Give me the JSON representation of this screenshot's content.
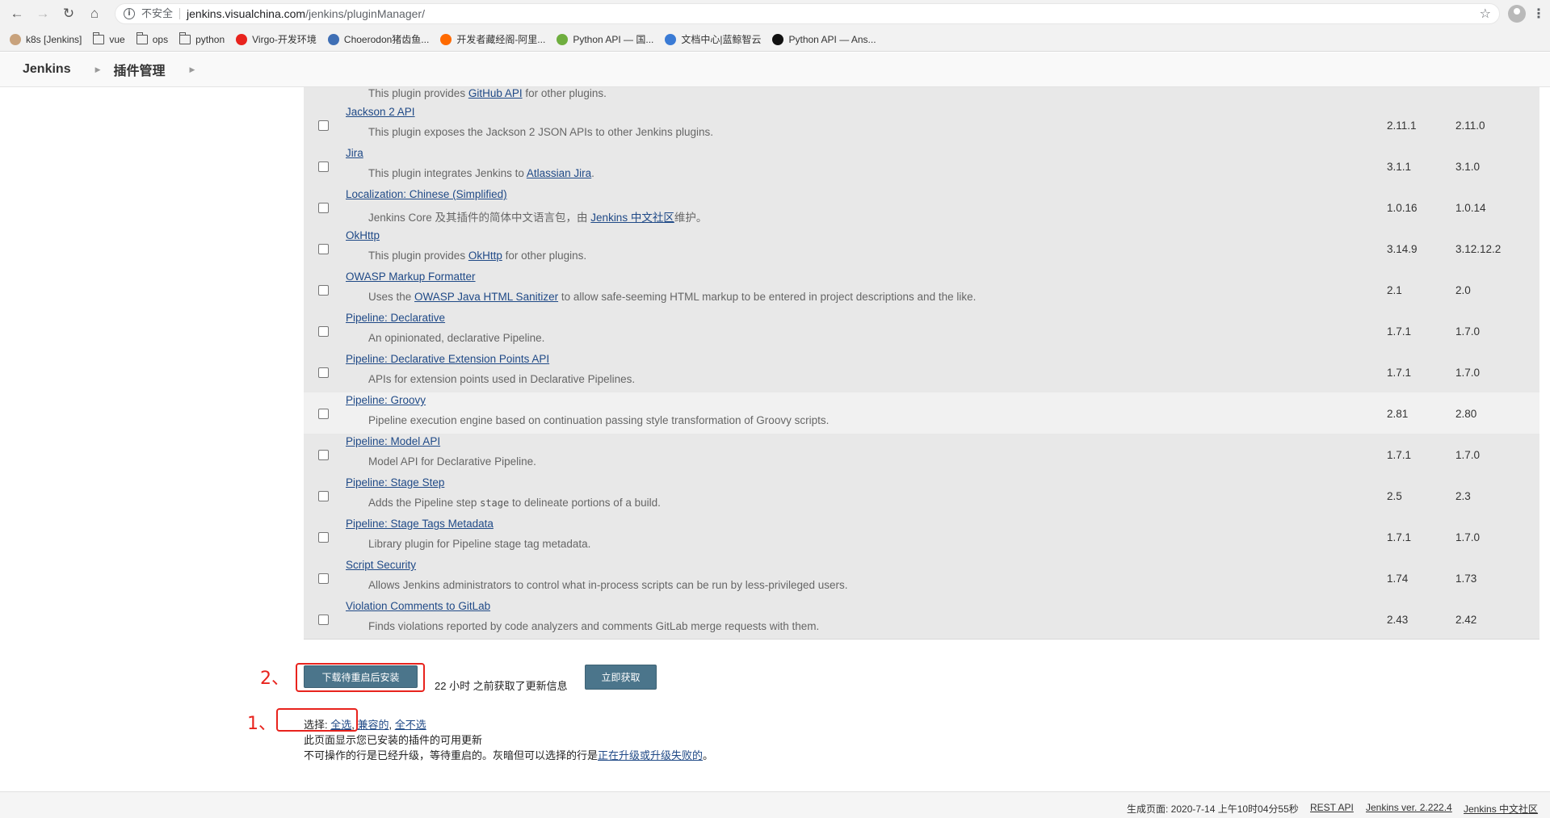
{
  "browser": {
    "insecure_label": "不安全",
    "url_host": "jenkins.visualchina.com",
    "url_path": "/jenkins/pluginManager/",
    "bookmarks": [
      {
        "label": "k8s [Jenkins]",
        "icon": "jenkins-icon"
      },
      {
        "label": "vue",
        "icon": "folder-icon"
      },
      {
        "label": "ops",
        "icon": "folder-icon"
      },
      {
        "label": "python",
        "icon": "folder-icon"
      },
      {
        "label": "Virgo-开发环境",
        "icon": "vcg-icon"
      },
      {
        "label": "Choerodon猪齿鱼...",
        "icon": "choerodon-icon"
      },
      {
        "label": "开发者藏经阁-阿里...",
        "icon": "aliyun-icon"
      },
      {
        "label": "Python API — 国...",
        "icon": "python-icon"
      },
      {
        "label": "文档中心|蓝鲸智云",
        "icon": "cloud-icon"
      },
      {
        "label": "Python API — Ans...",
        "icon": "ansible-icon"
      }
    ]
  },
  "header": {
    "crumb_home": "Jenkins",
    "crumb_page": "插件管理"
  },
  "table": {
    "top_desc_prefix": "This plugin provides ",
    "top_desc_link": "GitHub API",
    "top_desc_suffix": " for other plugins.",
    "rows": [
      {
        "name": "Jackson 2 API",
        "desc_pre": "This plugin exposes the Jackson 2 JSON APIs to other Jenkins plugins.",
        "version": "2.11.1",
        "previous": "2.11.0"
      },
      {
        "name": "Jira",
        "desc_pre": "This plugin integrates Jenkins to ",
        "desc_link": "Atlassian Jira",
        "desc_post": ".",
        "version": "3.1.1",
        "previous": "3.1.0"
      },
      {
        "name": "Localization: Chinese (Simplified)",
        "desc_pre": "Jenkins Core 及其插件的简体中文语言包，由 ",
        "desc_link": "Jenkins 中文社区",
        "desc_post": "维护。",
        "version": "1.0.16",
        "previous": "1.0.14"
      },
      {
        "name": "OkHttp",
        "desc_pre": "This plugin provides ",
        "desc_link": "OkHttp",
        "desc_post": " for other plugins.",
        "version": "3.14.9",
        "previous": "3.12.12.2"
      },
      {
        "name": "OWASP Markup Formatter",
        "desc_pre": "Uses the ",
        "desc_link": "OWASP Java HTML Sanitizer",
        "desc_post": " to allow safe-seeming HTML markup to be entered in project descriptions and the like.",
        "version": "2.1",
        "previous": "2.0"
      },
      {
        "name": "Pipeline: Declarative",
        "desc_pre": "An opinionated, declarative Pipeline.",
        "version": "1.7.1",
        "previous": "1.7.0"
      },
      {
        "name": "Pipeline: Declarative Extension Points API",
        "desc_pre": "APIs for extension points used in Declarative Pipelines.",
        "version": "1.7.1",
        "previous": "1.7.0"
      },
      {
        "name": "Pipeline: Groovy",
        "desc_pre": "Pipeline execution engine based on continuation passing style transformation of Groovy scripts.",
        "version": "2.81",
        "previous": "2.80",
        "highlight": true
      },
      {
        "name": "Pipeline: Model API",
        "desc_pre": "Model API for Declarative Pipeline.",
        "version": "1.7.1",
        "previous": "1.7.0"
      },
      {
        "name": "Pipeline: Stage Step",
        "desc_pre": "Adds the Pipeline step ",
        "desc_code": "stage",
        "desc_post": " to delineate portions of a build.",
        "version": "2.5",
        "previous": "2.3"
      },
      {
        "name": "Pipeline: Stage Tags Metadata",
        "desc_pre": "Library plugin for Pipeline stage tag metadata.",
        "version": "1.7.1",
        "previous": "1.7.0"
      },
      {
        "name": "Script Security",
        "desc_pre": "Allows Jenkins administrators to control what in-process scripts can be run by less-privileged users.",
        "version": "1.74",
        "previous": "1.73"
      },
      {
        "name": "Violation Comments to GitLab",
        "desc_pre": "Finds violations reported by code analyzers and comments GitLab merge requests with them.",
        "version": "2.43",
        "previous": "2.42"
      }
    ]
  },
  "actions": {
    "annotation_2": "2、",
    "annotation_1": "1、",
    "install_button": "下载待重启后安装",
    "last_check": "22 小时 之前获取了更新信息",
    "check_now_button": "立即获取",
    "select_label": "选择: ",
    "select_all": "全选",
    "select_compatible": "兼容的",
    "select_none": "全不选",
    "sep": ", ",
    "info_line1": "此页面显示您已安装的插件的可用更新",
    "info_line2_pre": "不可操作的行是已经升级，等待重启的。灰暗但可以选择的行是",
    "info_line2_link": "正在升级或升级失败的",
    "info_line2_post": "。"
  },
  "footer": {
    "generated": "生成页面: 2020-7-14 上午10时04分55秒",
    "rest_api": "REST API",
    "version": "Jenkins ver. 2.222.4",
    "community": "Jenkins 中文社区"
  }
}
